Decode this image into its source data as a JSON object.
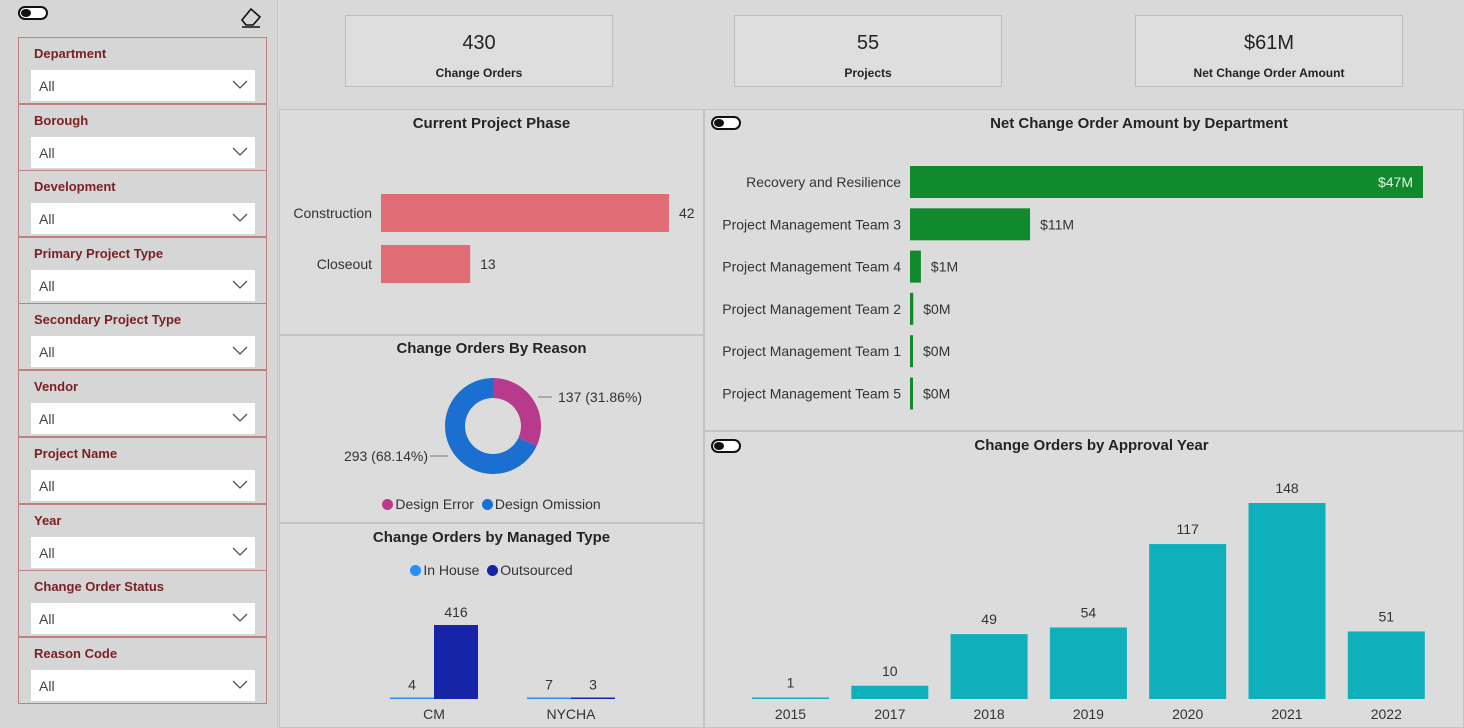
{
  "filters": [
    {
      "label": "Department",
      "value": "All"
    },
    {
      "label": "Borough",
      "value": "All"
    },
    {
      "label": "Development",
      "value": "All"
    },
    {
      "label": "Primary Project Type",
      "value": "All"
    },
    {
      "label": "Secondary Project Type",
      "value": "All"
    },
    {
      "label": "Vendor",
      "value": "All"
    },
    {
      "label": "Project Name",
      "value": "All"
    },
    {
      "label": "Year",
      "value": "All"
    },
    {
      "label": "Change Order Status",
      "value": "All"
    },
    {
      "label": "Reason Code",
      "value": "All"
    }
  ],
  "kpis": [
    {
      "value": "430",
      "label": "Change Orders"
    },
    {
      "value": "55",
      "label": "Projects"
    },
    {
      "value": "$61M",
      "label": "Net Change Order Amount"
    }
  ],
  "colors": {
    "phase_bar": "#e06c75",
    "dept_bar": "#118a2e",
    "year_bar": "#0fb0bc",
    "design_error": "#b83a8c",
    "design_omission": "#1a6fd1",
    "in_house": "#2a8ff0",
    "outsourced": "#1624a8",
    "filter_label": "#7a1f22"
  },
  "chart_data": [
    {
      "type": "bar",
      "title": "Current Project Phase",
      "orientation": "horizontal",
      "categories": [
        "Construction",
        "Closeout"
      ],
      "values": [
        42,
        13
      ],
      "value_labels": [
        "42",
        "13"
      ]
    },
    {
      "type": "pie",
      "title": "Change Orders By Reason",
      "style": "donut",
      "categories": [
        "Design Error",
        "Design Omission"
      ],
      "values": [
        137,
        293
      ],
      "value_labels": [
        "137 (31.86%)",
        "293 (68.14%)"
      ],
      "legend": "bottom"
    },
    {
      "type": "bar",
      "title": "Change Orders by Managed Type",
      "categories": [
        "CM",
        "NYCHA"
      ],
      "series": [
        {
          "name": "In House",
          "values": [
            4,
            7
          ],
          "value_labels": [
            "4",
            "7"
          ]
        },
        {
          "name": "Outsourced",
          "values": [
            416,
            3
          ],
          "value_labels": [
            "416",
            "3"
          ]
        }
      ],
      "legend": "top"
    },
    {
      "type": "bar",
      "title": "Net Change Order Amount by Department",
      "orientation": "horizontal",
      "categories": [
        "Recovery and Resilience",
        "Project Management Team 3",
        "Project Management Team 4",
        "Project Management Team 2",
        "Project Management Team 1",
        "Project Management Team 5"
      ],
      "values": [
        47,
        11,
        1,
        0.3,
        0.2,
        0.1
      ],
      "value_labels": [
        "$47M",
        "$11M",
        "$1M",
        "$0M",
        "$0M",
        "$0M"
      ],
      "unit": "$M"
    },
    {
      "type": "bar",
      "title": "Change Orders by Approval Year",
      "categories": [
        "2015",
        "2017",
        "2018",
        "2019",
        "2020",
        "2021",
        "2022"
      ],
      "values": [
        1,
        10,
        49,
        54,
        117,
        148,
        51
      ],
      "value_labels": [
        "1",
        "10",
        "49",
        "54",
        "117",
        "148",
        "51"
      ]
    }
  ]
}
